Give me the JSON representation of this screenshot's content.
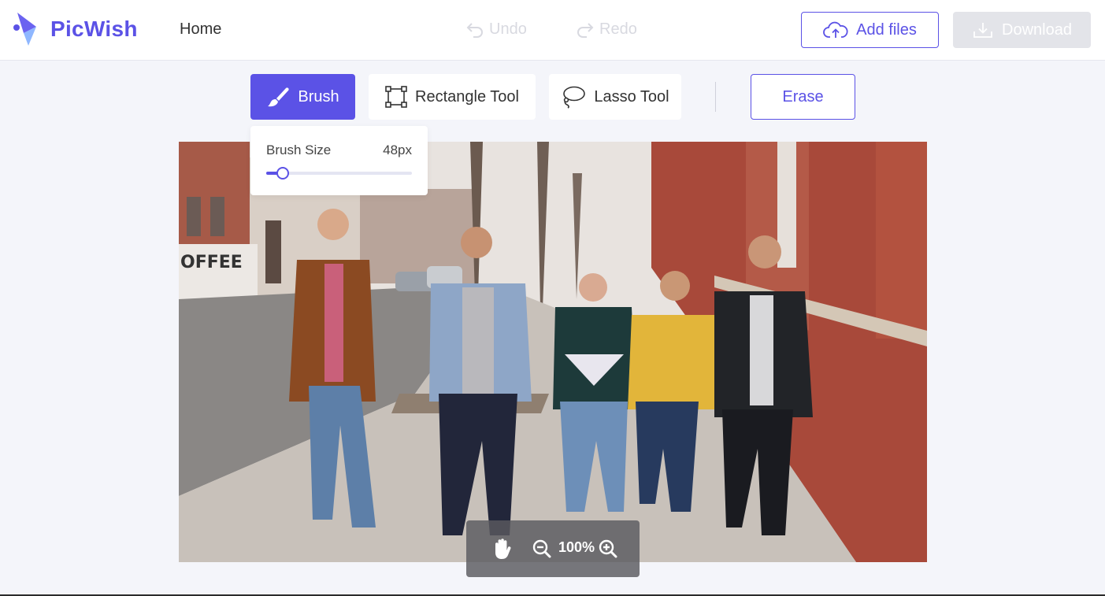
{
  "app": {
    "name": "PicWish",
    "brand_color": "#5b52e6"
  },
  "header": {
    "nav_home": "Home",
    "undo_label": "Undo",
    "redo_label": "Redo",
    "add_files_label": "Add files",
    "download_label": "Download"
  },
  "toolbar": {
    "brush_label": "Brush",
    "rectangle_label": "Rectangle Tool",
    "lasso_label": "Lasso Tool",
    "erase_label": "Erase",
    "active_tool": "brush"
  },
  "brush_popover": {
    "label": "Brush Size",
    "value_text": "48px",
    "slider_fraction": 0.09
  },
  "zoom": {
    "level": "100%"
  },
  "canvas": {
    "image_description_icon": "photo-of-five-people-walking"
  }
}
